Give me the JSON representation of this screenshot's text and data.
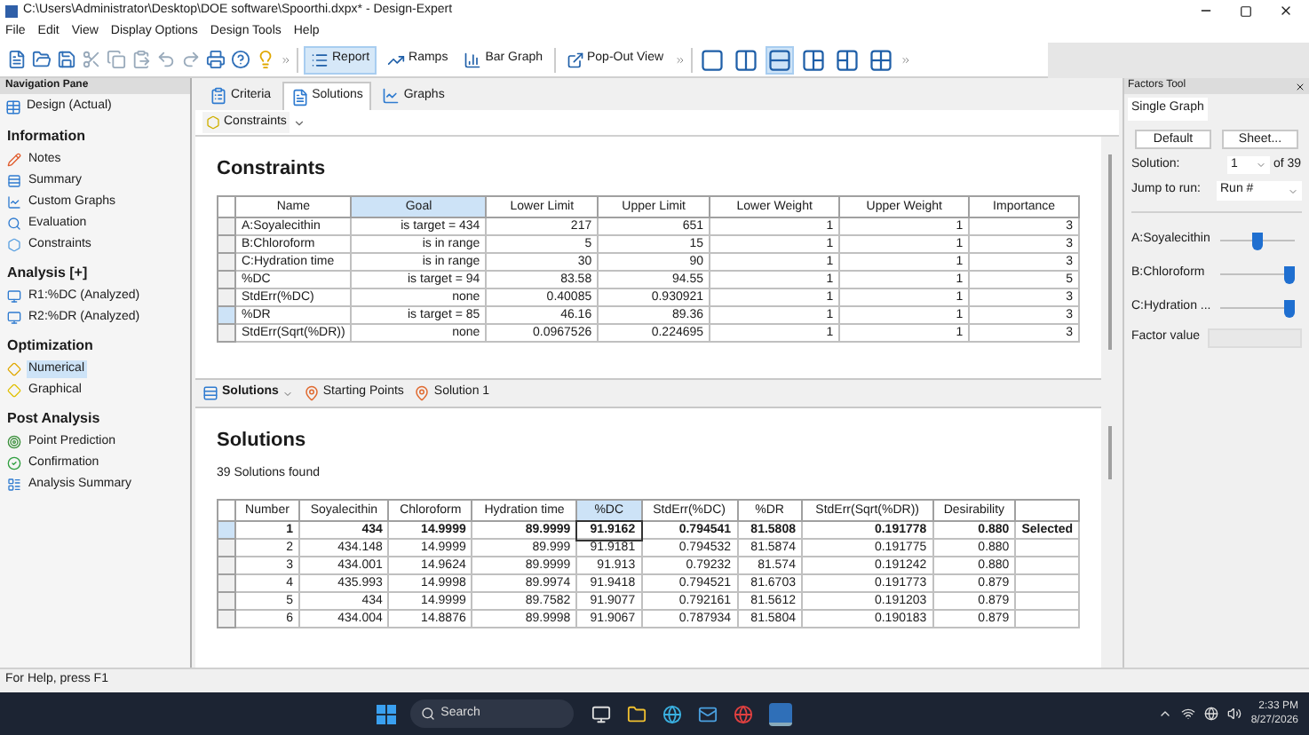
{
  "window": {
    "title": "C:\\Users\\Administrator\\Desktop\\DOE software\\Spoorthi.dxpx* - Design-Expert"
  },
  "menu": [
    "File",
    "Edit",
    "View",
    "Display Options",
    "Design Tools",
    "Help"
  ],
  "toolbar": {
    "views": [
      {
        "label": "Report",
        "selected": true
      },
      {
        "label": "Ramps",
        "selected": false
      },
      {
        "label": "Bar Graph",
        "selected": false
      }
    ],
    "popout": "Pop-Out View",
    "layouts": [
      {
        "selected": false
      },
      {
        "selected": false
      },
      {
        "selected": true
      },
      {
        "selected": false
      },
      {
        "selected": false
      },
      {
        "selected": false
      }
    ]
  },
  "navigation": {
    "title": "Navigation Pane",
    "top_item": "Design (Actual)",
    "sections": [
      {
        "heading": "Information",
        "items": [
          {
            "label": "Notes",
            "selected": false
          },
          {
            "label": "Summary",
            "selected": false
          },
          {
            "label": "Custom Graphs",
            "selected": false
          },
          {
            "label": "Evaluation",
            "selected": false
          },
          {
            "label": "Constraints",
            "selected": false
          }
        ]
      },
      {
        "heading": "Analysis [+]",
        "items": [
          {
            "label": "R1:%DC (Analyzed)",
            "selected": false
          },
          {
            "label": "R2:%DR (Analyzed)",
            "selected": false
          }
        ]
      },
      {
        "heading": "Optimization",
        "items": [
          {
            "label": "Numerical",
            "selected": true
          },
          {
            "label": "Graphical",
            "selected": false
          }
        ]
      },
      {
        "heading": "Post Analysis",
        "items": [
          {
            "label": "Point Prediction",
            "selected": false
          },
          {
            "label": "Confirmation",
            "selected": false
          },
          {
            "label": "Analysis Summary",
            "selected": false
          }
        ]
      }
    ]
  },
  "tabs": [
    {
      "label": "Criteria",
      "selected": false
    },
    {
      "label": "Solutions",
      "selected": true
    },
    {
      "label": "Graphs",
      "selected": false
    }
  ],
  "view_dropdown": "Constraints",
  "constraints": {
    "title": "Constraints",
    "columns": [
      {
        "label": "Name",
        "selected": false
      },
      {
        "label": "Goal",
        "selected": true
      },
      {
        "label": "Lower Limit",
        "selected": false
      },
      {
        "label": "Upper Limit",
        "selected": false
      },
      {
        "label": "Lower Weight",
        "selected": false
      },
      {
        "label": "Upper Weight",
        "selected": false
      },
      {
        "label": "Importance",
        "selected": false
      }
    ],
    "rows": [
      {
        "selected": false,
        "cells": [
          "A:Soyalecithin",
          "is target = 434",
          "217",
          "651",
          "1",
          "1",
          "3"
        ]
      },
      {
        "selected": false,
        "cells": [
          "B:Chloroform",
          "is in range",
          "5",
          "15",
          "1",
          "1",
          "3"
        ]
      },
      {
        "selected": false,
        "cells": [
          "C:Hydration time",
          "is in range",
          "30",
          "90",
          "1",
          "1",
          "3"
        ]
      },
      {
        "selected": false,
        "cells": [
          "%DC",
          "is target = 94",
          "83.58",
          "94.55",
          "1",
          "1",
          "5"
        ]
      },
      {
        "selected": false,
        "cells": [
          "StdErr(%DC)",
          "none",
          "0.40085",
          "0.930921",
          "1",
          "1",
          "3"
        ]
      },
      {
        "selected": true,
        "cells": [
          "%DR",
          "is target = 85",
          "46.16",
          "89.36",
          "1",
          "1",
          "3"
        ]
      },
      {
        "selected": false,
        "cells": [
          "StdErr(Sqrt(%DR))",
          "none",
          "0.0967526",
          "0.224695",
          "1",
          "1",
          "3"
        ]
      }
    ]
  },
  "pane_tabs": [
    {
      "label": "Solutions",
      "kind": "menu"
    },
    {
      "label": "Starting Points",
      "kind": "pin"
    },
    {
      "label": "Solution 1",
      "kind": "pin"
    }
  ],
  "solutions": {
    "title": "Solutions",
    "count": "39 Solutions found",
    "columns": [
      {
        "label": "Number",
        "selected": false
      },
      {
        "label": "Soyalecithin",
        "selected": false
      },
      {
        "label": "Chloroform",
        "selected": false
      },
      {
        "label": "Hydration time",
        "selected": false
      },
      {
        "label": "%DC",
        "selected": true
      },
      {
        "label": "StdErr(%DC)",
        "selected": false
      },
      {
        "label": "%DR",
        "selected": false
      },
      {
        "label": "StdErr(Sqrt(%DR))",
        "selected": false
      },
      {
        "label": "Desirability",
        "selected": false
      }
    ],
    "rows": [
      {
        "selected": true,
        "cells": [
          "1",
          "434",
          "14.9999",
          "89.9999",
          "91.9162",
          "0.794541",
          "81.5808",
          "0.191778",
          "0.880"
        ],
        "status": "Selected"
      },
      {
        "selected": false,
        "cells": [
          "2",
          "434.148",
          "14.9999",
          "89.999",
          "91.9181",
          "0.794532",
          "81.5874",
          "0.191775",
          "0.880"
        ]
      },
      {
        "selected": false,
        "cells": [
          "3",
          "434.001",
          "14.9624",
          "89.9999",
          "91.913",
          "0.79232",
          "81.574",
          "0.191242",
          "0.880"
        ]
      },
      {
        "selected": false,
        "cells": [
          "4",
          "435.993",
          "14.9998",
          "89.9974",
          "91.9418",
          "0.794521",
          "81.6703",
          "0.191773",
          "0.879"
        ]
      },
      {
        "selected": false,
        "cells": [
          "5",
          "434",
          "14.9999",
          "89.7582",
          "91.9077",
          "0.792161",
          "81.5612",
          "0.191203",
          "0.879"
        ]
      },
      {
        "selected": false,
        "cells": [
          "6",
          "434.004",
          "14.8876",
          "89.9998",
          "91.9067",
          "0.787934",
          "81.5804",
          "0.190183",
          "0.879"
        ]
      }
    ]
  },
  "factors_tool": {
    "title": "Factors Tool",
    "tab": "Single Graph",
    "buttons": [
      "Default",
      "Sheet..."
    ],
    "solution_label": "Solution:",
    "solution_value": "1",
    "solution_of": "of 39",
    "jump_label": "Jump to run:",
    "jump_value": "Run #",
    "factors": [
      {
        "name": "A:Soyalecithin",
        "level": 0.5
      },
      {
        "name": "B:Chloroform",
        "level": 1
      },
      {
        "name": "C:Hydration ...",
        "level": 1
      }
    ],
    "factor_value_label": "Factor value"
  },
  "status_bar": "For Help, press F1",
  "taskbar": {
    "search_placeholder": "Search",
    "time": "2:33 PM",
    "date": "8/27/2026"
  }
}
